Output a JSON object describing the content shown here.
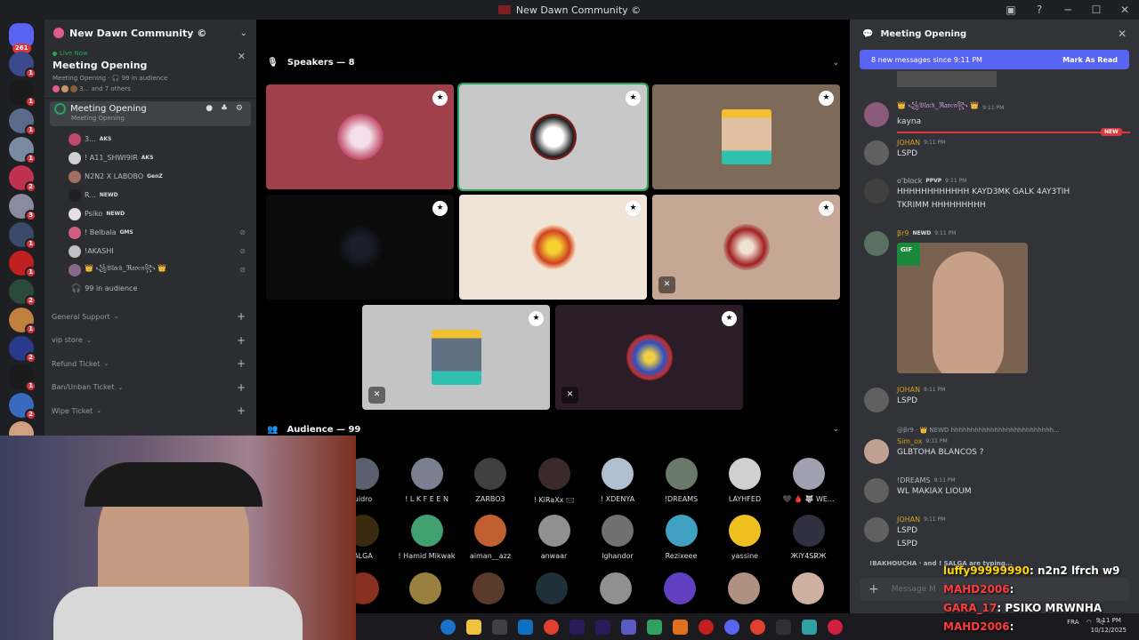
{
  "window": {
    "title": "New Dawn Community ©"
  },
  "rail": {
    "badges": [
      "261",
      "1",
      "1",
      "1",
      "1",
      "2",
      "3",
      "1",
      "1",
      "2",
      "1",
      "2",
      "1",
      "2",
      "1"
    ]
  },
  "sidebar": {
    "server_name": "New Dawn Community ©",
    "live": {
      "label": "Live Now",
      "name": "Meeting Opening",
      "subtitle": "Meeting Opening · 🎧 99 in audience",
      "others": "3... and 7 others"
    },
    "stage_channel": {
      "name": "Meeting Opening",
      "desc": "Meeting Opening"
    },
    "members": [
      {
        "name": "3...",
        "tag": "AKS",
        "muted": false
      },
      {
        "name": "! A11_SHWI9IR",
        "tag": "AKS",
        "muted": false
      },
      {
        "name": "N2N2 X LABOBO",
        "tag": "GenZ",
        "muted": false
      },
      {
        "name": "R...",
        "tag": "NEWD",
        "muted": false
      },
      {
        "name": "Psiko",
        "tag": "NEWD",
        "muted": false
      },
      {
        "name": "! Belbala",
        "tag": "GMS",
        "muted": true
      },
      {
        "name": "!AKASHI",
        "tag": "",
        "muted": true
      },
      {
        "name": "👑 ꧁𝔅𝔩𝔞𝔠𝔨_ℜ𝔞𝔳𝔢𝔫꧂ 👑",
        "tag": "",
        "muted": true
      }
    ],
    "audience_count": "99 in audience",
    "categories": [
      "General Support",
      "vip store",
      "Refund Ticket",
      "Ban/Unban Ticket",
      "Wipe Ticket"
    ]
  },
  "stage": {
    "speakers_header": "Speakers — 8",
    "audience_header": "Audience — 99",
    "audience_row1": [
      "uidro",
      "! L K F E E N",
      "ZARBO3",
      "! KiRaXx 🖂",
      "! XDENYA",
      "!DREAMS",
      "LAYHFED",
      "🖤 🩸 🐺 WE..."
    ],
    "audience_row2": [
      "ALGA",
      "! Hamid Mikwak",
      "aiman__azz",
      "anwaar",
      "lghandor",
      "Rezixeee",
      "yassine",
      "ЖiY4SR̷Ж"
    ]
  },
  "chat": {
    "header": "Meeting Opening",
    "new_messages": "8 new messages since 9:11 PM",
    "mark_read": "Mark As Read",
    "new_tag": "NEW",
    "messages": [
      {
        "author": "👑 ꧁𝔅𝔩𝔞𝔠𝔨_ℜ𝔞𝔳𝔢𝔫꧂ 👑",
        "time": "9:11 PM",
        "lines": [
          "kayna"
        ],
        "color": "#c9a0dc"
      },
      {
        "author": "JOHAN",
        "time": "9:11 PM",
        "lines": [
          "LSPD"
        ],
        "color": "#d4a017"
      },
      {
        "author": "o'block",
        "time": "9:11 PM",
        "tag": "PPVP",
        "lines": [
          "HHHHHHHHHHHH KAYD3MK GALK 4AY3TIH",
          "TKRIMM HHHHHHHHH"
        ],
        "color": "#b5bac1"
      },
      {
        "author": "βr9",
        "time": "9:11 PM",
        "tag": "NEWD",
        "lines": [],
        "color": "#d4a017"
      },
      {
        "author": "JOHAN",
        "time": "9:11 PM",
        "lines": [
          "LSPD"
        ],
        "color": "#d4a017"
      },
      {
        "author": "Sim_ox",
        "time": "9:11 PM",
        "lines": [
          "GLBTOHA BLANCOS ?"
        ],
        "color": "#d4a017"
      },
      {
        "author": "!DREAMS",
        "time": "9:11 PM",
        "lines": [
          "WL MAKIAX LIOUM"
        ],
        "color": "#b5bac1"
      },
      {
        "author": "JOHAN",
        "time": "9:11 PM",
        "lines": [
          "LSPD",
          "LSPD"
        ],
        "color": "#d4a017"
      }
    ],
    "reply_preview": "@βr9 · 👑 NEWD hhhhhhhhhhhhhhhhhhhhhhhhhh...",
    "gif_label": "GIF",
    "typing": "!BAKHOUCHA · and ! SALGA are typing...",
    "composer_placeholder": "Message M"
  },
  "overlay_chat": [
    {
      "user": "luffy99999990",
      "text": ": n2n2 lfrch w9",
      "color": "#ffd700"
    },
    {
      "user": "MAHD2006",
      "text": ":",
      "color": "#ff3b3b"
    },
    {
      "user": "GARA_17",
      "text": ": PSIKO MRWNHA",
      "color": "#ff3b3b"
    },
    {
      "user": "MAHD2006",
      "text": ":",
      "color": "#ff3b3b"
    }
  ],
  "taskbar": {
    "time": "9:11 PM",
    "date": "10/12/2025",
    "lang": "FRA"
  }
}
